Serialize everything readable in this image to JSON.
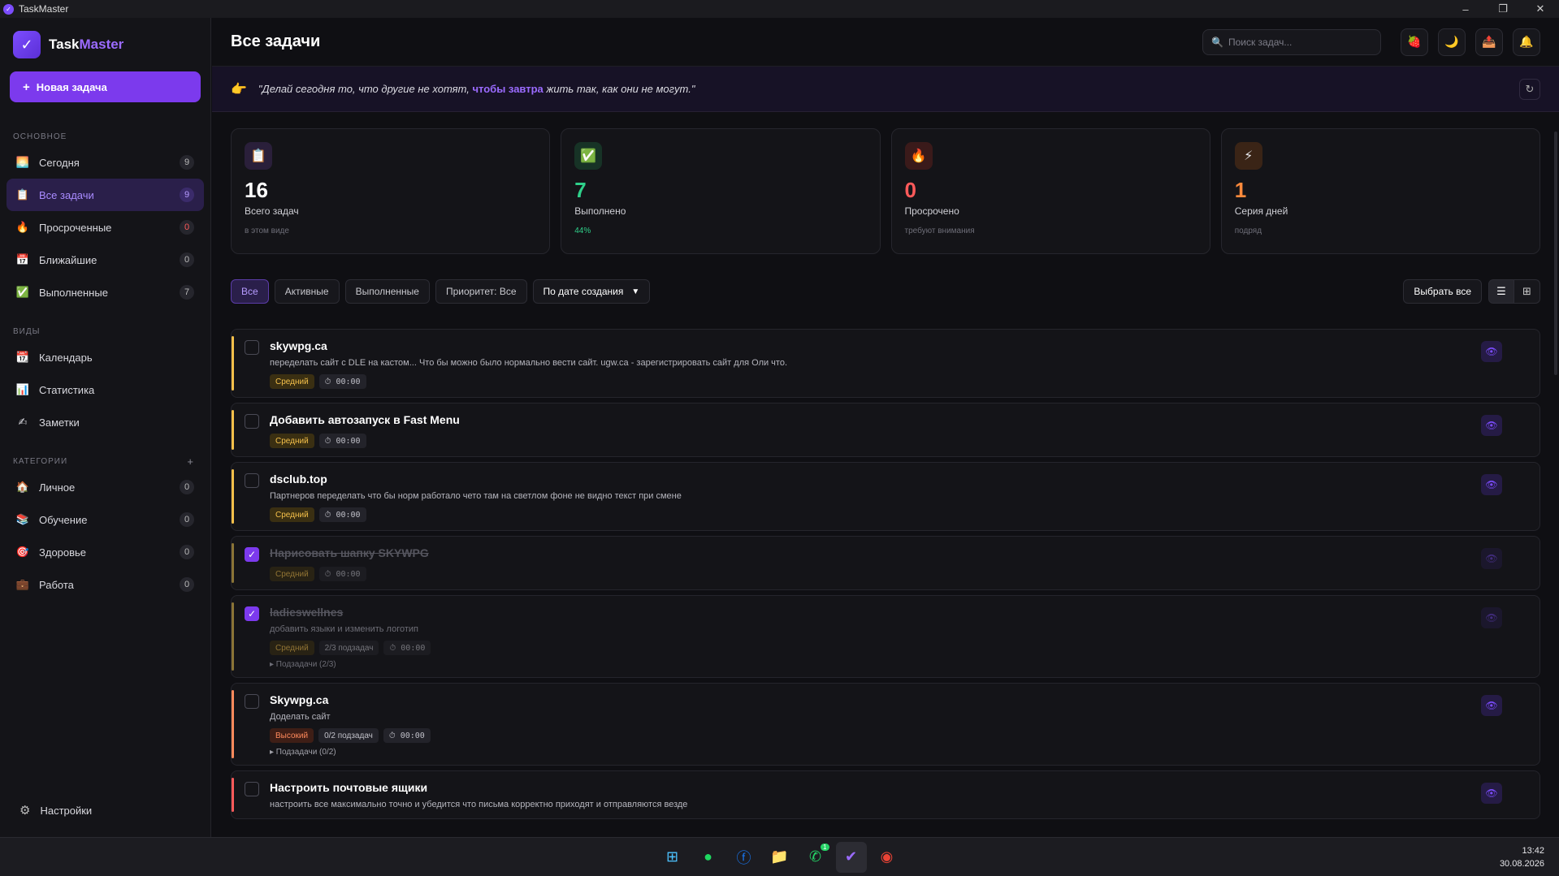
{
  "window": {
    "title": "TaskMaster",
    "minimize": "–",
    "maximize": "❐",
    "close": "✕"
  },
  "sidebar": {
    "logo_a": "Task",
    "logo_b": "Master",
    "new_task": "Новая задача",
    "section_main": "ОСНОВНОЕ",
    "main_items": [
      {
        "label": "Сегодня",
        "count": "9",
        "icon": "sunrise-icon"
      },
      {
        "label": "Все задачи",
        "count": "9",
        "icon": "clipboard-icon"
      },
      {
        "label": "Просроченные",
        "count": "0",
        "icon": "fire-icon"
      },
      {
        "label": "Ближайшие",
        "count": "0",
        "icon": "calendar-icon"
      },
      {
        "label": "Выполненные",
        "count": "7",
        "icon": "check-icon"
      }
    ],
    "section_views": "ВИДЫ",
    "view_items": [
      {
        "label": "Календарь",
        "icon": "calendar-icon"
      },
      {
        "label": "Статистика",
        "icon": "chart-icon"
      },
      {
        "label": "Заметки",
        "icon": "note-icon"
      }
    ],
    "section_categories": "КАТЕГОРИИ",
    "add_category": "+",
    "category_items": [
      {
        "label": "Личное",
        "count": "0",
        "icon": "home-icon"
      },
      {
        "label": "Обучение",
        "count": "0",
        "icon": "books-icon"
      },
      {
        "label": "Здоровье",
        "count": "0",
        "icon": "target-icon"
      },
      {
        "label": "Работа",
        "count": "0",
        "icon": "briefcase-icon"
      }
    ],
    "settings": "Настройки"
  },
  "header": {
    "title": "Все задачи",
    "search_placeholder": "Поиск задач..."
  },
  "quote": {
    "part1": "\"Делай сегодня то, что другие не хотят, ",
    "highlight": "чтобы завтра",
    "part2": " жить так, как они не могут.\""
  },
  "stats": [
    {
      "value": "16",
      "label": "Всего задач",
      "sub": "в этом виде",
      "color": "#ffffff"
    },
    {
      "value": "7",
      "label": "Выполнено",
      "sub": "44%",
      "color": "#2fd08a"
    },
    {
      "value": "0",
      "label": "Просрочено",
      "sub": "требуют внимания",
      "color": "#ff5a5a"
    },
    {
      "value": "1",
      "label": "Серия дней",
      "sub": "подряд",
      "color": "#ff8a3c"
    }
  ],
  "filters": {
    "all": "Все",
    "active": "Активные",
    "completed": "Выполненные",
    "priority": "Приоритет: Все",
    "sort": "По дате создания",
    "select_all": "Выбрать все"
  },
  "tasks": [
    {
      "title": "skywpg.ca",
      "desc": "переделать сайт с DLE на кастом... Что бы можно было нормально вести сайт. ugw.ca - зарегистрировать сайт для Оли что.",
      "priority": "Средний",
      "time": "⏱ 00:00"
    },
    {
      "title": "Добавить автозапуск в Fast Menu",
      "priority": "Средний",
      "time": "⏱ 00:00"
    },
    {
      "title": "dsclub.top",
      "desc": "Партнеров переделать что бы норм работало чето там на светлом фоне не видно текст при смене",
      "priority": "Средний",
      "time": "⏱ 00:00"
    },
    {
      "title": "Нарисовать шапку SKYWPG",
      "priority": "Средний",
      "time": "⏱ 00:00"
    },
    {
      "title": "ladieswellnes",
      "desc": "добавить языки и изменить логотип",
      "priority": "Средний",
      "subtasks": "2/3 подзадач",
      "time": "⏱ 00:00",
      "subtask_toggle": "▸ Подзадачи (2/3)"
    },
    {
      "title": "Skywpg.ca",
      "desc": "Доделать сайт",
      "priority": "Высокий",
      "subtasks": "0/2 подзадач",
      "time": "⏱ 00:00",
      "subtask_toggle": "▸ Подзадачи (0/2)"
    },
    {
      "title": "Настроить почтовые ящики",
      "desc": "настроить все максимально точно и убедится что письма корректно приходят и отправляются везде"
    }
  ],
  "taskbar": {
    "time": "13:42",
    "date": "30.08.2026",
    "badge": "1"
  }
}
